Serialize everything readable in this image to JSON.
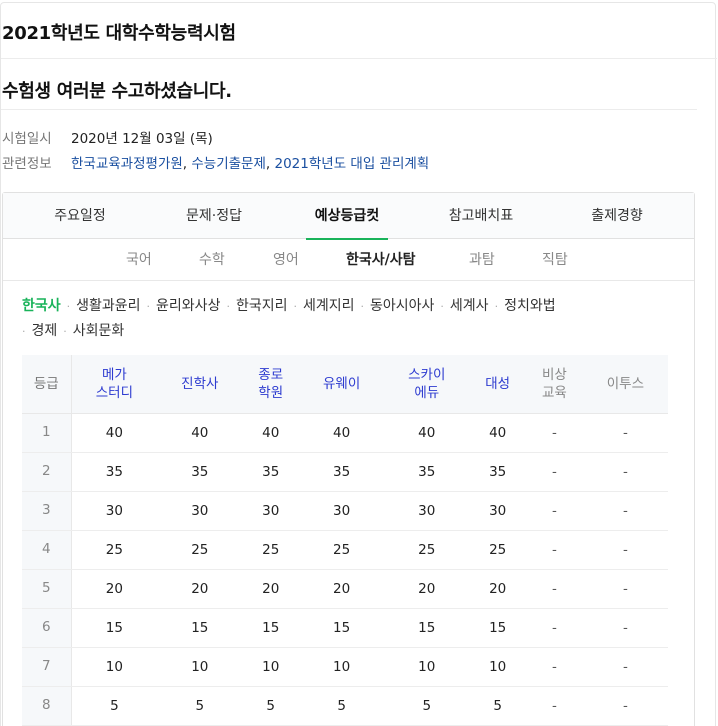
{
  "page": {
    "title": "2021학년도 대학수학능력시험",
    "subtitle": "수험생 여러분 수고하셨습니다.",
    "exam_date_label": "시험일시",
    "exam_date_value": "2020년 12월 03일 (목)",
    "related_label": "관련정보",
    "related_links": [
      "한국교육과정평가원",
      "수능기출문제",
      "2021학년도 대입 관리계획"
    ],
    "link_color": "#1a4fa0"
  },
  "tabs": [
    "주요일정",
    "문제·정답",
    "예상등급컷",
    "참고배치표",
    "출제경향"
  ],
  "active_tab": "예상등급컷",
  "subtabs": [
    "국어",
    "수학",
    "영어",
    "한국사/사탐",
    "과탐",
    "직탐"
  ],
  "active_subtab": "한국사/사탐",
  "subjects": [
    "한국사",
    "생활과윤리",
    "윤리와사상",
    "한국지리",
    "세계지리",
    "동아시아사",
    "세계사",
    "정치와법",
    "경제",
    "사회문화"
  ],
  "active_subject": "한국사",
  "accent_color": "#19b35a",
  "table": {
    "rank_header": "등급",
    "providers": [
      [
        "메가",
        "스터디"
      ],
      [
        "진학사"
      ],
      [
        "종로",
        "학원"
      ],
      [
        "유웨이"
      ],
      [
        "스카이",
        "에듀"
      ],
      [
        "대성"
      ],
      [
        "비상",
        "교육"
      ],
      [
        "이투스"
      ]
    ],
    "rows": [
      [
        "1",
        "40",
        "40",
        "40",
        "40",
        "40",
        "40",
        "-",
        "-"
      ],
      [
        "2",
        "35",
        "35",
        "35",
        "35",
        "35",
        "35",
        "-",
        "-"
      ],
      [
        "3",
        "30",
        "30",
        "30",
        "30",
        "30",
        "30",
        "-",
        "-"
      ],
      [
        "4",
        "25",
        "25",
        "25",
        "25",
        "25",
        "25",
        "-",
        "-"
      ],
      [
        "5",
        "20",
        "20",
        "20",
        "20",
        "20",
        "20",
        "-",
        "-"
      ],
      [
        "6",
        "15",
        "15",
        "15",
        "15",
        "15",
        "15",
        "-",
        "-"
      ],
      [
        "7",
        "10",
        "10",
        "10",
        "10",
        "10",
        "10",
        "-",
        "-"
      ],
      [
        "8",
        "5",
        "5",
        "5",
        "5",
        "5",
        "5",
        "-",
        "-"
      ]
    ]
  }
}
